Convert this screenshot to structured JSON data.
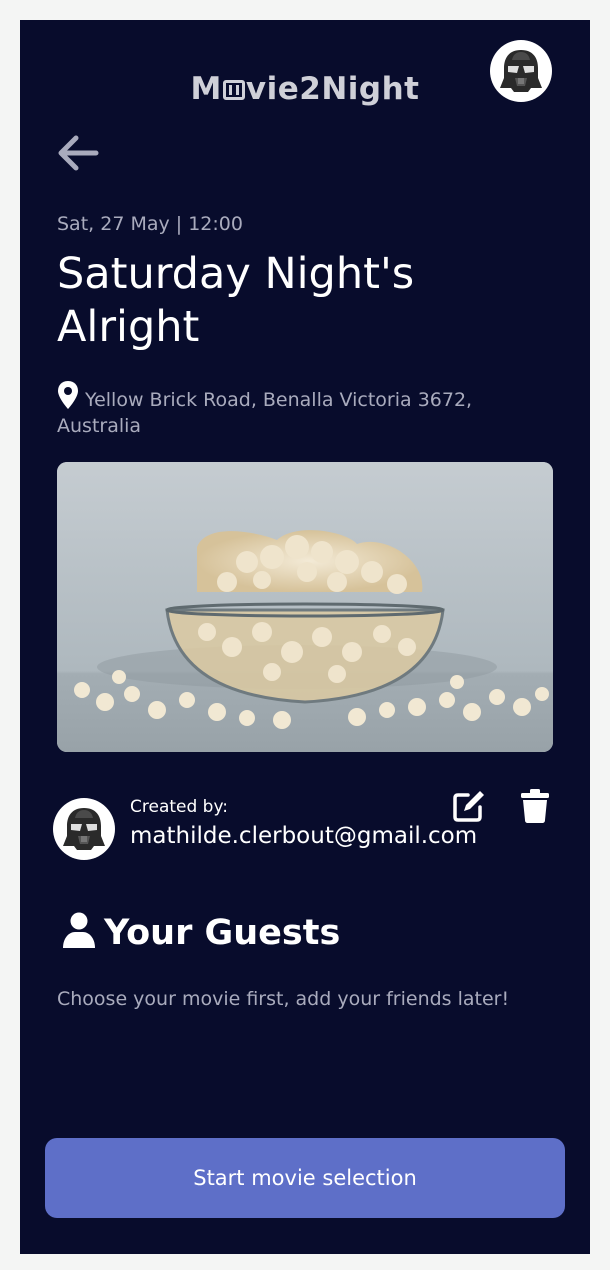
{
  "header": {
    "logo_prefix": "M",
    "logo_suffix": "vie2Night",
    "logo_icon": "film-reel-icon",
    "avatar_icon": "darth-vader-helmet-icon"
  },
  "event": {
    "datetime": "Sat, 27 May | 12:00",
    "title": "Saturday Night's Alright",
    "location": "Yellow Brick Road, Benalla Victoria 3672, Australia",
    "image_icon": "popcorn-bowl-image"
  },
  "creator": {
    "label": "Created by:",
    "email": "mathilde.clerbout@gmail.com",
    "avatar_icon": "darth-vader-helmet-icon"
  },
  "guests": {
    "heading": "Your Guests",
    "note": "Choose your movie first, add your friends later!"
  },
  "actions": {
    "start_label": "Start movie selection"
  },
  "colors": {
    "background": "#080c2c",
    "muted_text": "#a9abbd",
    "primary_button": "#5e6fc8"
  }
}
